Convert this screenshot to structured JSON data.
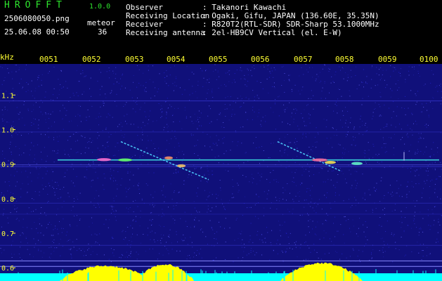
{
  "app": {
    "title": "HROFFT",
    "version": "1.0.0"
  },
  "file_name": "2506080050.png",
  "date_time": "25.06.08 00:50",
  "meteor": {
    "label": "meteor",
    "count": "36"
  },
  "info": [
    {
      "label": "Observer",
      "value": ": Takanori Kawachi"
    },
    {
      "label": "Receiving Location",
      "value": ": Ogaki, Gifu, JAPAN (136.60E, 35.35N)"
    },
    {
      "label": "Receiver",
      "value": ": R820T2(RTL-SDR) SDR-Sharp 53.1000MHz"
    },
    {
      "label": "Receiving antenna",
      "value": ": 2el-HB9CV Vertical (el. E-W)"
    }
  ],
  "axis": {
    "unit": "kHz",
    "freq_range": [
      0.58,
      1.19
    ],
    "freq_ticks": [
      "1.1",
      "1.0",
      "0.9",
      "0.8",
      "0.7",
      "0.6"
    ],
    "time_labels": [
      "0051",
      "0052",
      "0053",
      "0054",
      "0055",
      "0056",
      "0057",
      "0058",
      "0059",
      "0100"
    ]
  },
  "colors": {
    "background": "#10107a",
    "axis_text": "#ffff33",
    "title_green": "#2ee52e",
    "signal_cyan": "#3fe0e0",
    "level_yellow": "#ffff00",
    "level_cyan": "#00ffff"
  }
}
